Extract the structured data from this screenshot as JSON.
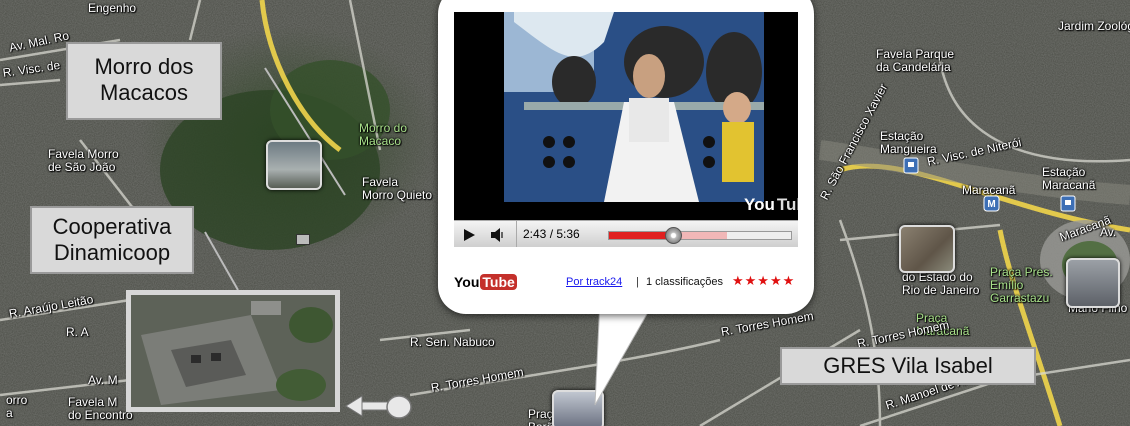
{
  "map": {
    "labels": [
      {
        "id": "engenho",
        "text": "Engenho",
        "style": "white"
      },
      {
        "id": "av-mal-ro",
        "text": "Av. Mal. Ro",
        "style": "white"
      },
      {
        "id": "r-visc-de",
        "text": "R. Visc. de",
        "style": "white"
      },
      {
        "id": "favela-morro-sao-joao",
        "text": "Favela Morro\nde São João",
        "style": "white"
      },
      {
        "id": "morro-do-macaco",
        "text": "Morro do\nMacaco",
        "style": "green"
      },
      {
        "id": "favela-morro-quieto",
        "text": "Favela\nMorro Quieto",
        "style": "white"
      },
      {
        "id": "r-araujo-leitao",
        "text": "R. Araújo Leitão",
        "style": "white"
      },
      {
        "id": "r-a",
        "text": "R. A",
        "style": "white"
      },
      {
        "id": "av-m",
        "text": "Av. M",
        "style": "white"
      },
      {
        "id": "favela-m-do-encontro",
        "text": "Favela M\ndo Encontro",
        "style": "white"
      },
      {
        "id": "orro",
        "text": "orro\na",
        "style": "white"
      },
      {
        "id": "r-sen-nabuco",
        "text": "R. Sen. Nabuco",
        "style": "white"
      },
      {
        "id": "r-torres-homem-left",
        "text": "R. Torres Homem",
        "style": "white"
      },
      {
        "id": "r-torres-homem-right",
        "text": "R. Torres Homem",
        "style": "white"
      },
      {
        "id": "praca-bottom",
        "text": "Praç\nBarã",
        "style": "white"
      },
      {
        "id": "jardim-zoologico",
        "text": "Jardim Zoológ",
        "style": "white"
      },
      {
        "id": "favela-parque-candelaria",
        "text": "Favela Parque\nda Candelária",
        "style": "white"
      },
      {
        "id": "estacao-mangueira",
        "text": "Estação\nMangueira",
        "style": "white"
      },
      {
        "id": "r-visc-de-niteroi",
        "text": "R. Visc. de Niterói",
        "style": "white"
      },
      {
        "id": "estacao-maracana",
        "text": "Estação\nMaracanã",
        "style": "white"
      },
      {
        "id": "maracana",
        "text": "Maracanã",
        "style": "white"
      },
      {
        "id": "maracana-road",
        "text": "Maracanã",
        "style": "white"
      },
      {
        "id": "r-sao-francisco-xavier",
        "text": "R. São Francisco Xavier",
        "style": "white"
      },
      {
        "id": "estado-rio",
        "text": "ide\ndo Estado do\nRio de Janeiro",
        "style": "white"
      },
      {
        "id": "praca-pres-emilio",
        "text": "Praça Pres.\nEmílio\nGarrastazu",
        "style": "green"
      },
      {
        "id": "praca-maracana",
        "text": "Praça\nMaracanã",
        "style": "green"
      },
      {
        "id": "mario-filho",
        "text": "Mário Filho",
        "style": "white"
      },
      {
        "id": "av",
        "text": "Av.",
        "style": "white"
      },
      {
        "id": "manoel-de-abreu",
        "text": "R. Manoel de Abreu",
        "style": "white"
      },
      {
        "id": "r-torres-homem-3",
        "text": "R. Torres Homem",
        "style": "white"
      }
    ],
    "callouts": [
      {
        "id": "morro-dos-macacos",
        "text": "Morro dos\nMacacos"
      },
      {
        "id": "cooperativa-dinamicoop",
        "text": "Cooperativa\nDinamicoop"
      },
      {
        "id": "gres-vila-isabel",
        "text": "GRES Vila Isabel"
      }
    ]
  },
  "video_popup": {
    "time": "2:43 / 5:36",
    "progress": 0.35,
    "buffered": 0.65,
    "author_link": "Por track24",
    "separator": "|",
    "ratings_text": "1 classificações",
    "stars": "★★★★★",
    "rating": 5,
    "watermark": {
      "you": "You",
      "tube": "Tube"
    },
    "footer_logo": {
      "you": "You",
      "tube": "Tube"
    }
  },
  "colors": {
    "callout_bg": "#d9d9d9",
    "popup_bg": "#ffffff",
    "star_red": "#e01010",
    "progress_red": "#e02020",
    "green_label": "#a8e08a"
  },
  "icons": [
    "play-icon",
    "volume-icon",
    "seek-knob-icon",
    "train-station-icon",
    "metro-icon",
    "arrow-left-icon"
  ]
}
